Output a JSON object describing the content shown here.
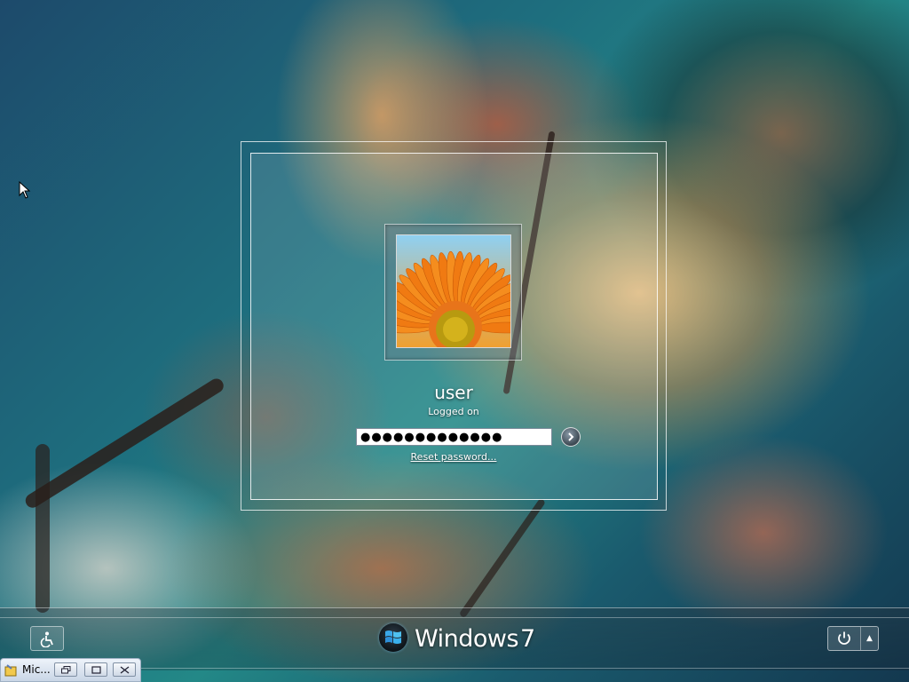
{
  "login": {
    "username": "user",
    "status": "Logged on",
    "password_masked": "●●●●●●●●●●●●●",
    "reset_link": "Reset password..."
  },
  "icons": {
    "submit": "arrow-right-icon",
    "ease_of_access": "accessibility-icon",
    "power": "power-icon",
    "shutdown_options": "triangle-up-icon",
    "cursor": "mouse-pointer-icon",
    "avatar": "flower-picture"
  },
  "branding": {
    "name": "Windows",
    "version": "7"
  },
  "minimized_window": {
    "title": "Mic..."
  },
  "colors": {
    "accent_glow": "#7ec8ff",
    "text": "#ffffff"
  }
}
